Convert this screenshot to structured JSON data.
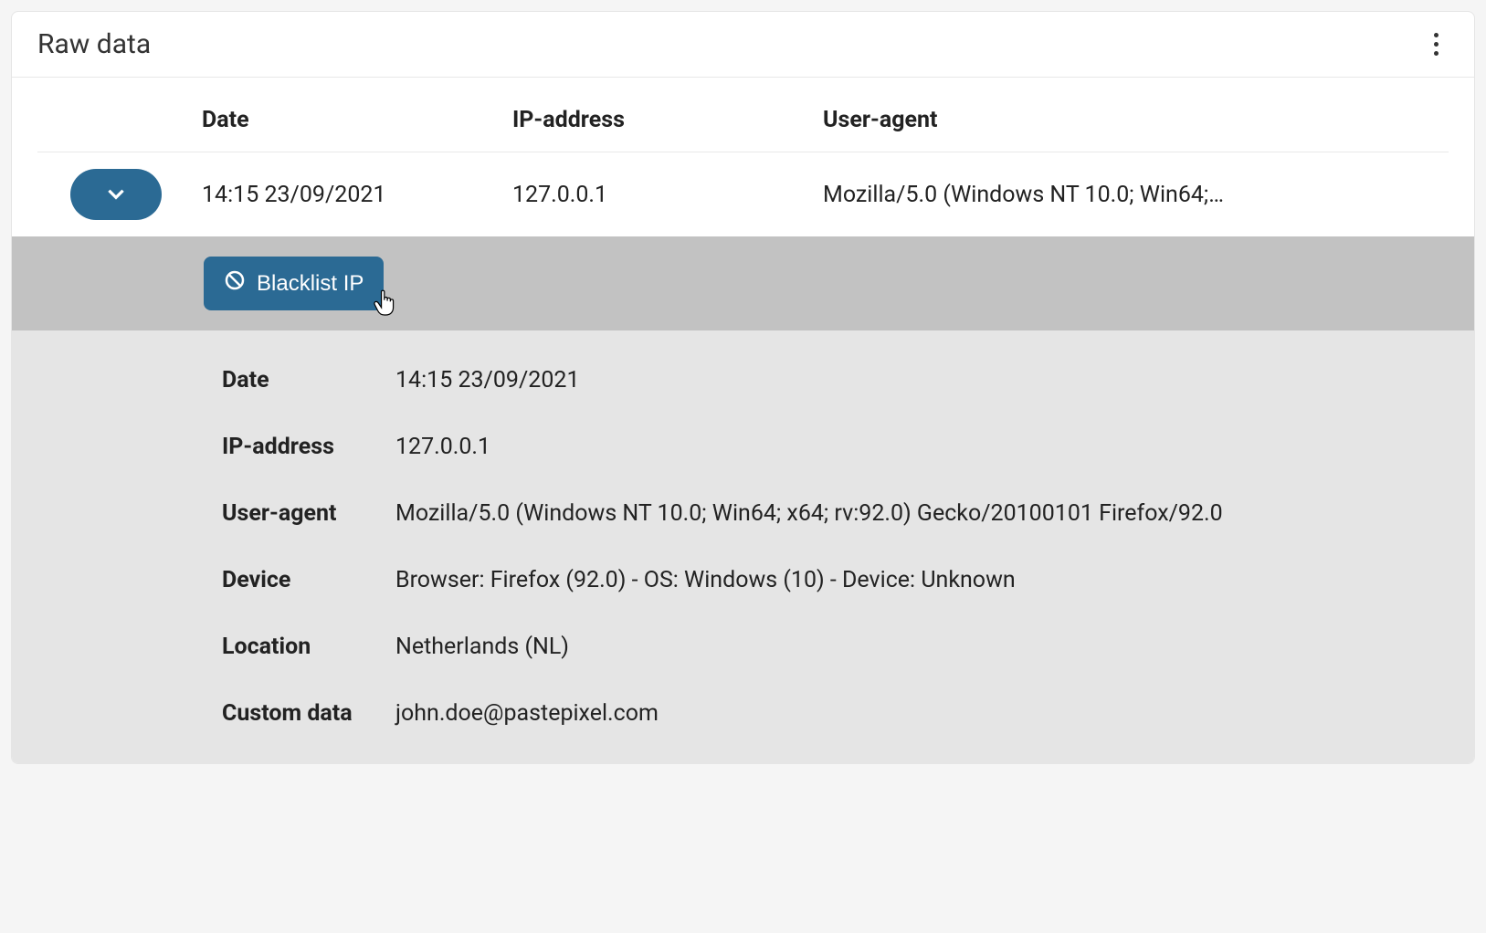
{
  "header": {
    "title": "Raw data"
  },
  "columns": {
    "date": "Date",
    "ip": "IP-address",
    "ua": "User-agent"
  },
  "row": {
    "date": "14:15 23/09/2021",
    "ip": "127.0.0.1",
    "ua": "Mozilla/5.0 (Windows NT 10.0; Win64;…"
  },
  "action": {
    "blacklist": "Blacklist IP"
  },
  "details": {
    "date_label": "Date",
    "date_value": "14:15 23/09/2021",
    "ip_label": "IP-address",
    "ip_value": "127.0.0.1",
    "ua_label": "User-agent",
    "ua_value": "Mozilla/5.0 (Windows NT 10.0; Win64; x64; rv:92.0) Gecko/20100101 Firefox/92.0",
    "device_label": "Device",
    "device_value": "Browser: Firefox (92.0) - OS: Windows (10) - Device: Unknown",
    "location_label": "Location",
    "location_value": "Netherlands (NL)",
    "custom_label": "Custom data",
    "custom_value": "john.doe@pastepixel.com"
  }
}
